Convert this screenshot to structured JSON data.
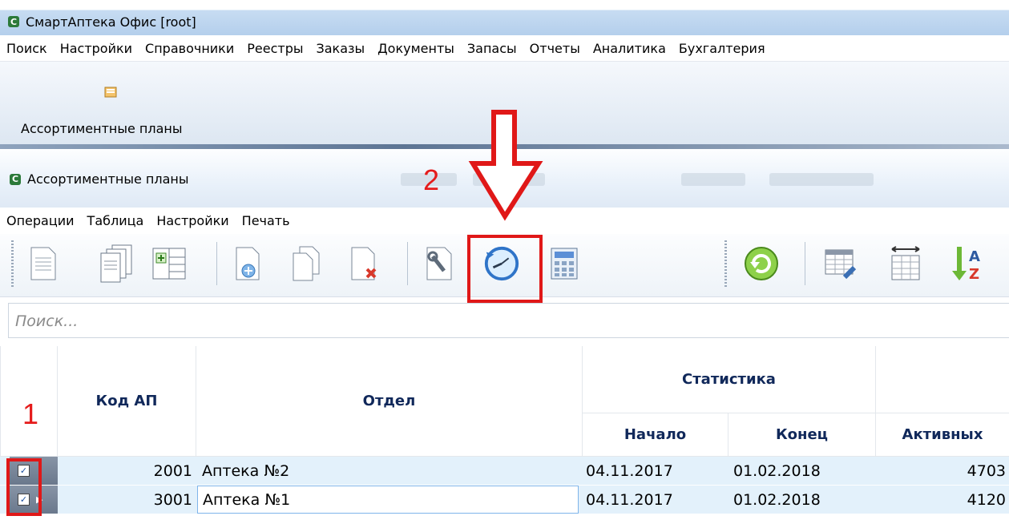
{
  "app": {
    "title": "СмартАптека Офис [root]"
  },
  "main_menu": [
    "Поиск",
    "Настройки",
    "Справочники",
    "Реестры",
    "Заказы",
    "Документы",
    "Запасы",
    "Отчеты",
    "Аналитика",
    "Бухгалтерия"
  ],
  "ribbon": {
    "button_label": "Ассортиментные планы",
    "button_icon": "folder-icon"
  },
  "window": {
    "title": "Ассортиментные планы"
  },
  "sub_menu": [
    "Операции",
    "Таблица",
    "Настройки",
    "Печать"
  ],
  "toolbar": {
    "buttons": [
      "new-document-icon",
      "copy-documents-icon",
      "add-column-icon",
      "new-file-add-icon",
      "copy-file-icon",
      "delete-file-icon",
      "settings-wrench-icon",
      "history-clock-icon",
      "calculator-icon",
      "refresh-icon",
      "table-settings-icon",
      "column-width-icon",
      "sort-az-icon"
    ]
  },
  "search": {
    "placeholder": "Поиск..."
  },
  "table": {
    "group_header": "Статистика",
    "columns": {
      "code": "Код АП",
      "dept": "Отдел",
      "start": "Начало",
      "end": "Конец",
      "active": "Активных"
    },
    "rows": [
      {
        "checked": true,
        "code": "2001",
        "dept": "Аптека №2",
        "start": "04.11.2017",
        "end": "01.02.2018",
        "active": "4703"
      },
      {
        "checked": true,
        "code": "3001",
        "dept": "Аптека №1",
        "start": "04.11.2017",
        "end": "01.02.2018",
        "active": "4120"
      }
    ]
  },
  "annotations": {
    "marker1": "1",
    "marker2": "2",
    "color": "#e01818"
  },
  "colors": {
    "header_text": "#10285a",
    "row_selected": "#e3f1fb"
  }
}
